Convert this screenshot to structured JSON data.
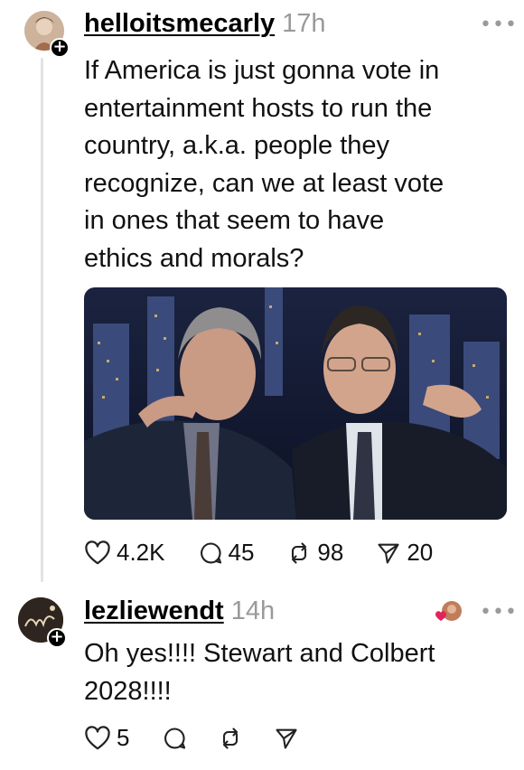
{
  "post": {
    "username": "helloitsmecarly",
    "time": "17h",
    "text_lines": [
      "If America is just gonna vote in",
      "entertainment hosts to run the",
      "country, a.k.a. people they",
      "recognize, can we at least vote",
      "in ones that seem to have",
      "ethics and morals?"
    ],
    "actions": {
      "likes": "4.2K",
      "replies": "45",
      "reposts": "98",
      "shares": "20"
    }
  },
  "reply": {
    "username": "lezliewendt",
    "time": "14h",
    "text_lines": [
      "Oh yes!!!! Stewart and Colbert",
      "2028!!!!"
    ],
    "actions": {
      "likes": "5"
    }
  },
  "icons": {
    "more": "more-dots-icon",
    "like": "heart-icon",
    "reply": "comment-icon",
    "repost": "repost-icon",
    "share": "send-icon",
    "follow": "plus-icon"
  },
  "colors": {
    "text": "#111111",
    "muted": "#9a9a9a",
    "thread_line": "#e3e3e3",
    "heart_red": "#e0245e"
  }
}
